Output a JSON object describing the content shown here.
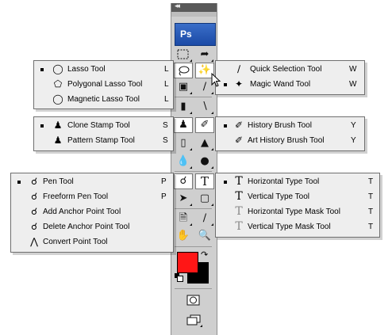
{
  "toolbar": {
    "collapse_glyph": "◂◂",
    "logo": "Ps"
  },
  "lasso_menu": {
    "items": [
      {
        "label": "Lasso Tool",
        "shortcut": "L",
        "icon": "lasso-icon",
        "selected": true
      },
      {
        "label": "Polygonal Lasso Tool",
        "shortcut": "L",
        "icon": "polygonal-lasso-icon",
        "selected": false
      },
      {
        "label": "Magnetic Lasso Tool",
        "shortcut": "L",
        "icon": "magnetic-lasso-icon",
        "selected": false
      }
    ]
  },
  "wand_menu": {
    "items": [
      {
        "label": "Quick Selection Tool",
        "shortcut": "W",
        "icon": "quick-selection-icon",
        "selected": false
      },
      {
        "label": "Magic Wand Tool",
        "shortcut": "W",
        "icon": "magic-wand-icon",
        "selected": true
      }
    ]
  },
  "stamp_menu": {
    "items": [
      {
        "label": "Clone Stamp Tool",
        "shortcut": "S",
        "icon": "clone-stamp-icon",
        "selected": true
      },
      {
        "label": "Pattern Stamp Tool",
        "shortcut": "S",
        "icon": "pattern-stamp-icon",
        "selected": false
      }
    ]
  },
  "history_menu": {
    "items": [
      {
        "label": "History Brush Tool",
        "shortcut": "Y",
        "icon": "history-brush-icon",
        "selected": true
      },
      {
        "label": "Art History Brush Tool",
        "shortcut": "Y",
        "icon": "art-history-brush-icon",
        "selected": false
      }
    ]
  },
  "pen_menu": {
    "items": [
      {
        "label": "Pen Tool",
        "shortcut": "P",
        "icon": "pen-icon",
        "selected": true
      },
      {
        "label": "Freeform Pen Tool",
        "shortcut": "P",
        "icon": "freeform-pen-icon",
        "selected": false
      },
      {
        "label": "Add Anchor Point Tool",
        "shortcut": "",
        "icon": "add-anchor-point-icon",
        "selected": false
      },
      {
        "label": "Delete Anchor Point Tool",
        "shortcut": "",
        "icon": "delete-anchor-point-icon",
        "selected": false
      },
      {
        "label": "Convert Point Tool",
        "shortcut": "",
        "icon": "convert-point-icon",
        "selected": false
      }
    ]
  },
  "type_menu": {
    "items": [
      {
        "label": "Horizontal Type Tool",
        "shortcut": "T",
        "icon": "horizontal-type-icon",
        "selected": true
      },
      {
        "label": "Vertical Type Tool",
        "shortcut": "T",
        "icon": "vertical-type-icon",
        "selected": false
      },
      {
        "label": "Horizontal Type Mask Tool",
        "shortcut": "T",
        "icon": "horizontal-type-mask-icon",
        "selected": false
      },
      {
        "label": "Vertical Type Mask Tool",
        "shortcut": "T",
        "icon": "vertical-type-mask-icon",
        "selected": false
      }
    ]
  },
  "colors": {
    "foreground": "#ff1616",
    "background": "#000000",
    "toolbar": "#cfcfcf",
    "flyout": "#eeeeee"
  }
}
